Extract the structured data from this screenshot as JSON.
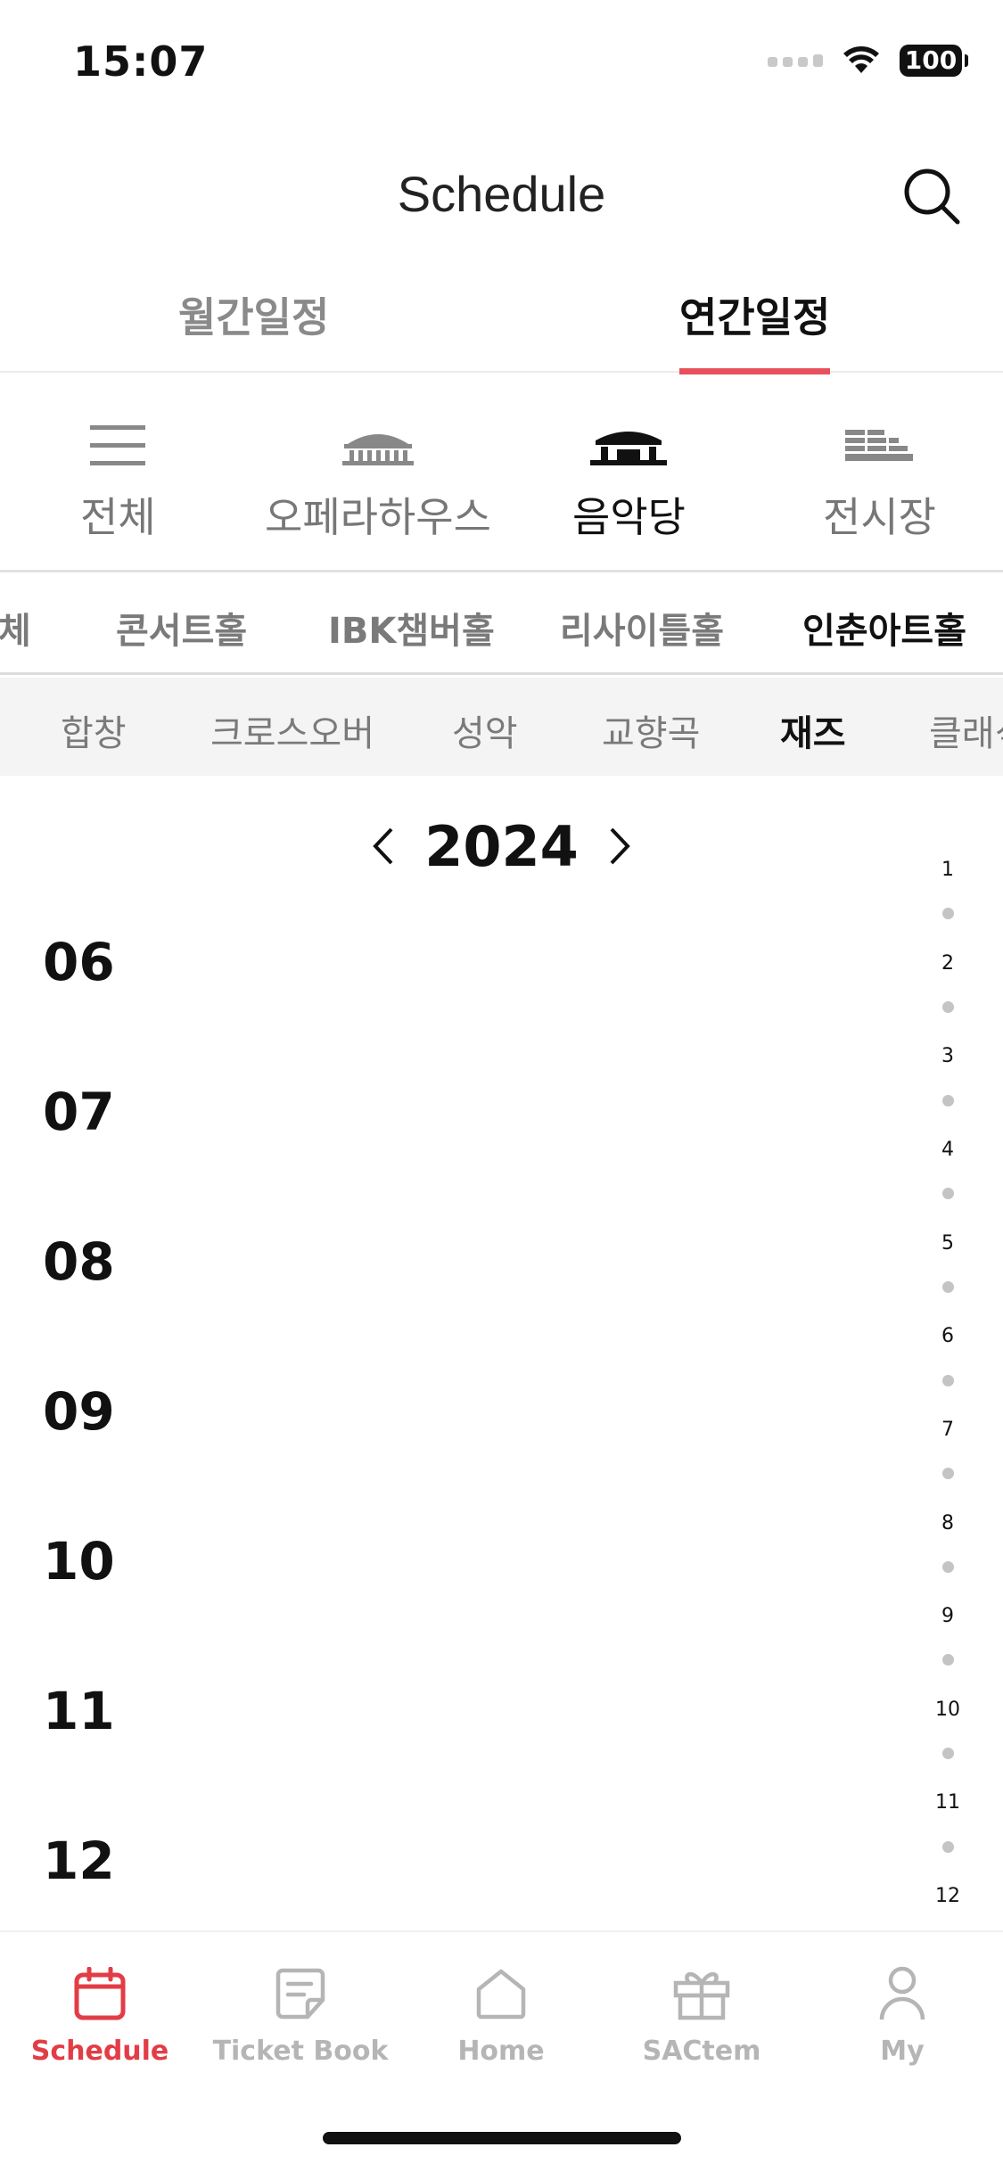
{
  "status_bar": {
    "time": "15:07",
    "battery": "100"
  },
  "header": {
    "title": "Schedule"
  },
  "top_tabs": [
    {
      "label": "월간일정",
      "active": false
    },
    {
      "label": "연간일정",
      "active": true
    }
  ],
  "venues": [
    {
      "label": "전체",
      "icon": "list-icon",
      "active": false
    },
    {
      "label": "오페라하우스",
      "icon": "opera-house-icon",
      "active": false
    },
    {
      "label": "음악당",
      "icon": "concert-hall-icon",
      "active": true
    },
    {
      "label": "전시장",
      "icon": "exhibition-icon",
      "active": false
    }
  ],
  "halls": [
    {
      "label": "체",
      "active": false
    },
    {
      "label": "콘서트홀",
      "active": false
    },
    {
      "label": "IBK챔버홀",
      "active": false
    },
    {
      "label": "리사이틀홀",
      "active": false
    },
    {
      "label": "인춘아트홀",
      "active": true
    }
  ],
  "genres": [
    {
      "label": "합창",
      "active": false
    },
    {
      "label": "크로스오버",
      "active": false
    },
    {
      "label": "성악",
      "active": false
    },
    {
      "label": "교향곡",
      "active": false
    },
    {
      "label": "재즈",
      "active": true
    },
    {
      "label": "클래식",
      "active": false
    }
  ],
  "year": "2024",
  "months": [
    "06",
    "07",
    "08",
    "09",
    "10",
    "11",
    "12"
  ],
  "month_index": [
    "1",
    "2",
    "3",
    "4",
    "5",
    "6",
    "7",
    "8",
    "9",
    "10",
    "11",
    "12"
  ],
  "bottom_nav": [
    {
      "label": "Schedule",
      "icon": "calendar-icon",
      "active": true
    },
    {
      "label": "Ticket Book",
      "icon": "ticket-book-icon",
      "active": false
    },
    {
      "label": "Home",
      "icon": "home-icon",
      "active": false
    },
    {
      "label": "SACtem",
      "icon": "gift-icon",
      "active": false
    },
    {
      "label": "My",
      "icon": "user-icon",
      "active": false
    }
  ],
  "colors": {
    "accent": "#e8505b",
    "nav_active": "#e23d46",
    "inactive": "#7a7a7a",
    "genre_bg": "#f4f4f4"
  }
}
